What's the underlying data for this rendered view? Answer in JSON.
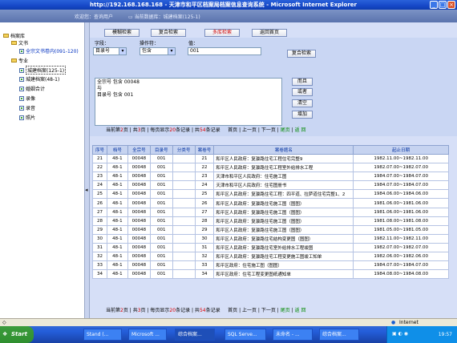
{
  "window": {
    "title": "http://192.168.168.168 - 天津市和平区档案局档案信息查询系统 - Microsoft Internet Explorer"
  },
  "banner": {
    "welcome": "欢迎您：查询用户",
    "current_db": "当前数据库：城建档案(125-1)"
  },
  "sidebar": {
    "root": "档案库",
    "groups": [
      {
        "label": "文书",
        "items": [
          {
            "label": "全宗文书卷内(091-120)",
            "selected": false
          }
        ]
      },
      {
        "label": "专业",
        "items": [
          {
            "label": "城建档案(125-1)",
            "selected": true
          },
          {
            "label": "城建档案(48-1)",
            "selected": false
          },
          {
            "label": "婚姻合计",
            "selected": false
          },
          {
            "label": "录像",
            "selected": false
          },
          {
            "label": "录音",
            "selected": false
          },
          {
            "label": "照片",
            "selected": false
          }
        ]
      }
    ]
  },
  "nav": {
    "buttons": [
      "模糊检索",
      "复合检索",
      "多库检索",
      "返回首页"
    ]
  },
  "search": {
    "field_label": "字段：",
    "operator_label": "操作符：",
    "value_label": "值：",
    "field_value": "目录号",
    "operator_value": "包含",
    "value_value": "001",
    "query_button": "复合检索",
    "conditions": [
      "全宗号 包含 00048",
      "与",
      "目录号 包含 001"
    ],
    "side_buttons": [
      "而且",
      "或者",
      "清空",
      "增加"
    ]
  },
  "pager": {
    "current_page_label": "当前第",
    "current_page": "2",
    "page_suffix": "页",
    "total_label": "共",
    "total_pages": "3",
    "total_suffix": "页",
    "per_page_label": "每页显示",
    "per_page": "20",
    "per_page_suffix": "条记录",
    "total_records_label": "共",
    "total_records": "54",
    "records_suffix": "条记录",
    "first": "首页",
    "prev": "上一页",
    "next": "下一页",
    "last": "尾页",
    "back": "返 回"
  },
  "table": {
    "columns": [
      "序号",
      "档号",
      "全宗号",
      "目录号",
      "分类号",
      "案卷号",
      "案卷题名",
      "起止日期"
    ],
    "rows": [
      [
        "21",
        "48-1",
        "00048",
        "001",
        "",
        "21",
        "和平区人民政府：复瀛路住宅工程住宅完整9",
        "1982.11.00~1982.11.00"
      ],
      [
        "22",
        "48-1",
        "00048",
        "001",
        "",
        "22",
        "和平区人民政府：复瀛路住宅工程室外给排水工程",
        "1982.07.00~1982.07.00"
      ],
      [
        "23",
        "48-1",
        "00048",
        "001",
        "",
        "23",
        "天津市和平区人民政府：住宅施工图",
        "1984.07.00~1984.07.00"
      ],
      [
        "24",
        "48-1",
        "00048",
        "001",
        "",
        "24",
        "天津市和平区人民政府：住宅图册书",
        "1984.07.00~1984.07.00"
      ],
      [
        "25",
        "48-1",
        "00048",
        "001",
        "",
        "25",
        "和平区人民政府：复瀛路住宅工程：四平道、拉萨道住宅完整1、2",
        "1984.06.00~1984.06.00"
      ],
      [
        "26",
        "48-1",
        "00048",
        "001",
        "",
        "26",
        "和平区人民政府：复瀛路住宅施工图（图图）",
        "1981.06.00~1981.06.00"
      ],
      [
        "27",
        "48-1",
        "00048",
        "001",
        "",
        "27",
        "和平区人民政府：复瀛路住宅施工图（图图）",
        "1981.06.00~1981.06.00"
      ],
      [
        "28",
        "48-1",
        "00048",
        "001",
        "",
        "28",
        "和平区人民政府：复瀛路住宅施工图（图图）",
        "1981.08.00~1981.08.00"
      ],
      [
        "29",
        "48-1",
        "00048",
        "001",
        "",
        "29",
        "和平区人民政府：复瀛路住宅施工图（图图）",
        "1981.05.00~1981.05.00"
      ],
      [
        "30",
        "48-1",
        "00048",
        "001",
        "",
        "30",
        "和平区人民政府：复瀛路住宅结构变更图（图图）",
        "1982.11.00~1982.11.00"
      ],
      [
        "31",
        "48-1",
        "00048",
        "001",
        "",
        "31",
        "和平区人民政府：复瀛路住宅室外给排水工程竣图",
        "1982.07.00~1982.07.00"
      ],
      [
        "32",
        "48-1",
        "00048",
        "001",
        "",
        "32",
        "和平区人民政府：复瀛路住宅工程变更施工图竣工知单",
        "1982.06.00~1982.06.00"
      ],
      [
        "33",
        "48-1",
        "00048",
        "001",
        "",
        "33",
        "和平区政府：住宅施工图（图图）",
        "1984.07.00~1984.07.00"
      ],
      [
        "34",
        "48-1",
        "00048",
        "001",
        "",
        "34",
        "和平区政府：住宅工程变更图纸通知单",
        "1984.08.00~1984.08.00"
      ]
    ]
  },
  "statusbar": {
    "zone": "Internet"
  },
  "taskbar": {
    "start": "Start",
    "tasks": [
      "Stand (...",
      "Microsoft ...",
      "综合档案...",
      "SQL Serve...",
      "未命名 - ...",
      "综合档案..."
    ],
    "clock": "19:57"
  }
}
